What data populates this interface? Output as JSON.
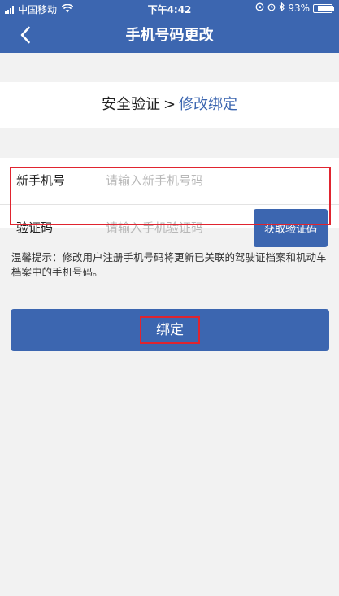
{
  "status_bar": {
    "carrier": "中国移动",
    "time": "下午4:42",
    "battery": "93%",
    "battery_level": 0.93
  },
  "nav": {
    "title": "手机号码更改"
  },
  "steps": {
    "current": "安全验证",
    "separator": ">",
    "next": "修改绑定"
  },
  "form": {
    "phone_label": "新手机号",
    "phone_placeholder": "请输入新手机号码",
    "code_label": "验证码",
    "code_placeholder": "请输入手机验证码",
    "get_code_button": "获取验证码"
  },
  "tip": "温馨提示：修改用户注册手机号码将更新已关联的驾驶证档案和机动车档案中的手机号码。",
  "bind_button": "绑定",
  "colors": {
    "primary": "#3c66b0",
    "highlight": "#e0242f"
  }
}
